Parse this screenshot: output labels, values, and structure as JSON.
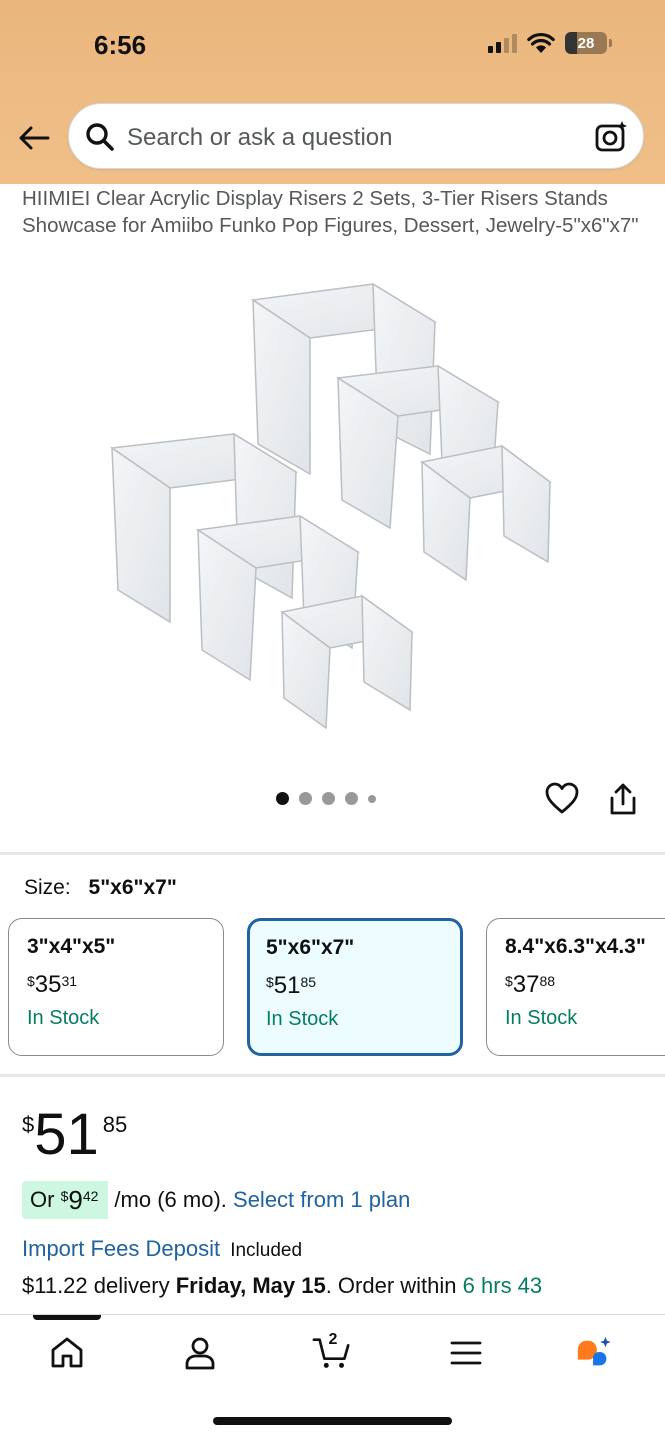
{
  "status_bar": {
    "time": "6:56",
    "battery": "28",
    "battery_level": 0.28
  },
  "search": {
    "placeholder": "Search or ask a question"
  },
  "product": {
    "title": "HIIMIEI Clear Acrylic Display Risers 2 Sets, 3-Tier Risers Stands Showcase for Amiibo Funko Pop Figures, Dessert, Jewelry-5\"x6\"x7\"",
    "image_count": 5,
    "active_image_index": 0
  },
  "size": {
    "label": "Size:",
    "selected": "5\"x6\"x7\"",
    "options": [
      {
        "name": "3\"x4\"x5\"",
        "currency": "$",
        "whole": "35",
        "cents": "31",
        "stock": "In Stock",
        "selected": false
      },
      {
        "name": "5\"x6\"x7\"",
        "currency": "$",
        "whole": "51",
        "cents": "85",
        "stock": "In Stock",
        "selected": true
      },
      {
        "name": "8.4\"x6.3\"x4.3\"",
        "currency": "$",
        "whole": "37",
        "cents": "88",
        "stock": "In Stock",
        "selected": false
      }
    ]
  },
  "price": {
    "currency": "$",
    "whole": "51",
    "cents": "85"
  },
  "installment": {
    "prefix": "Or",
    "currency": "$",
    "whole": "9",
    "cents": "42",
    "term": "/mo (6 mo).",
    "link": "Select from 1 plan"
  },
  "import_fees": {
    "link": "Import Fees Deposit",
    "status": "Included"
  },
  "delivery": {
    "cost": "$11.22 delivery",
    "date": "Friday, May 15",
    "order_within_label": ". Order within",
    "countdown": "6 hrs 43"
  },
  "bottom_nav": {
    "cart_count": "2"
  },
  "colors": {
    "header": "#f0bf88",
    "link": "#2162a1",
    "stock_green": "#067d62",
    "selected_border": "#2162a1",
    "installment_bg": "#cdf7e1"
  }
}
